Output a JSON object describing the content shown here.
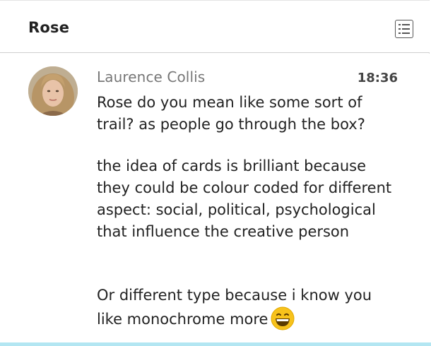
{
  "header": {
    "title": "Rose",
    "menu_icon": "list-icon"
  },
  "message": {
    "sender": "Laurence Collis",
    "time": "18:36",
    "paragraphs": [
      "Rose do you mean like some sort of trail? as people go through the box?",
      "the idea of cards is brilliant because they could be colour coded for different aspect: social, political, psychological that influence the creative person",
      "Or different type because i know you like monochrome more"
    ],
    "emoji": "grinning-face-icon"
  },
  "colors": {
    "accent_bar": "#b3e6f2",
    "emoji_yellow": "#f7c21b"
  }
}
